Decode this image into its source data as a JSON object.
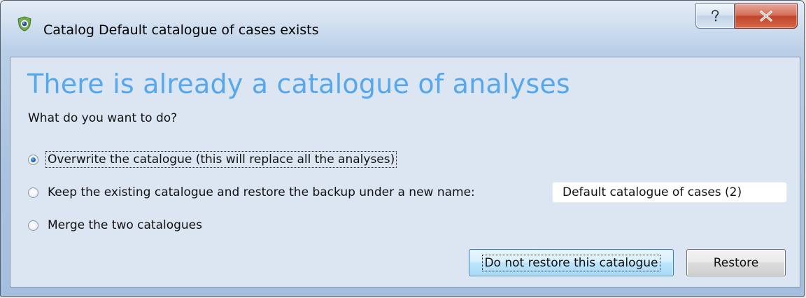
{
  "window": {
    "title": "Catalog Default catalogue of cases exists",
    "help_button_label": "?",
    "close_button_label": "x"
  },
  "dialog": {
    "heading": "There is already a catalogue of analyses",
    "question": "What do you want to do?",
    "options": [
      {
        "label": "Overwrite the catalogue (this will replace all the analyses)",
        "checked": true
      },
      {
        "label": "Keep the existing catalogue and restore the backup under a new name:",
        "checked": false
      },
      {
        "label": "Merge the two catalogues",
        "checked": false
      }
    ],
    "new_name_value": "Default catalogue of cases (2)",
    "buttons": {
      "do_not_restore": "Do not restore this catalogue",
      "restore": "Restore"
    }
  },
  "colors": {
    "heading": "#55a8ee",
    "client_background": "#dce6f3",
    "close_button": "#c14428"
  }
}
